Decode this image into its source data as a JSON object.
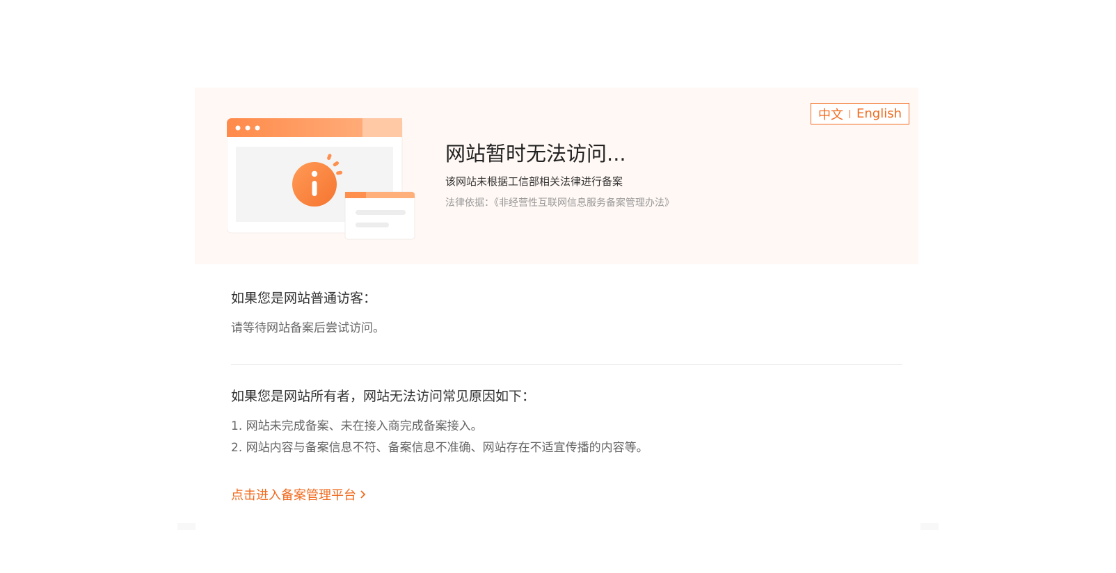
{
  "lang": {
    "zh": "中文",
    "en": "English"
  },
  "banner": {
    "title": "网站暂时无法访问...",
    "subtitle": "该网站未根据工信部相关法律进行备案",
    "legal": "法律依据：《非经营性互联网信息服务备案管理办法》"
  },
  "visitor": {
    "title": "如果您是网站普通访客：",
    "text": "请等待网站备案后尝试访问。"
  },
  "owner": {
    "title": "如果您是网站所有者，网站无法访问常见原因如下：",
    "reasons": [
      "1. 网站未完成备案、未在接入商完成备案接入。",
      "2. 网站内容与备案信息不符、备案信息不准确、网站存在不适宜传播的内容等。"
    ]
  },
  "link": {
    "label": "点击进入备案管理平台"
  },
  "colors": {
    "accent": "#f06a1d",
    "banner_bg": "#fff8f5",
    "illustration_orange": "#ff8f4d",
    "illustration_light": "#ffc7a3"
  },
  "icons": {
    "info": "info-icon",
    "chevron": "chevron-right-icon"
  }
}
